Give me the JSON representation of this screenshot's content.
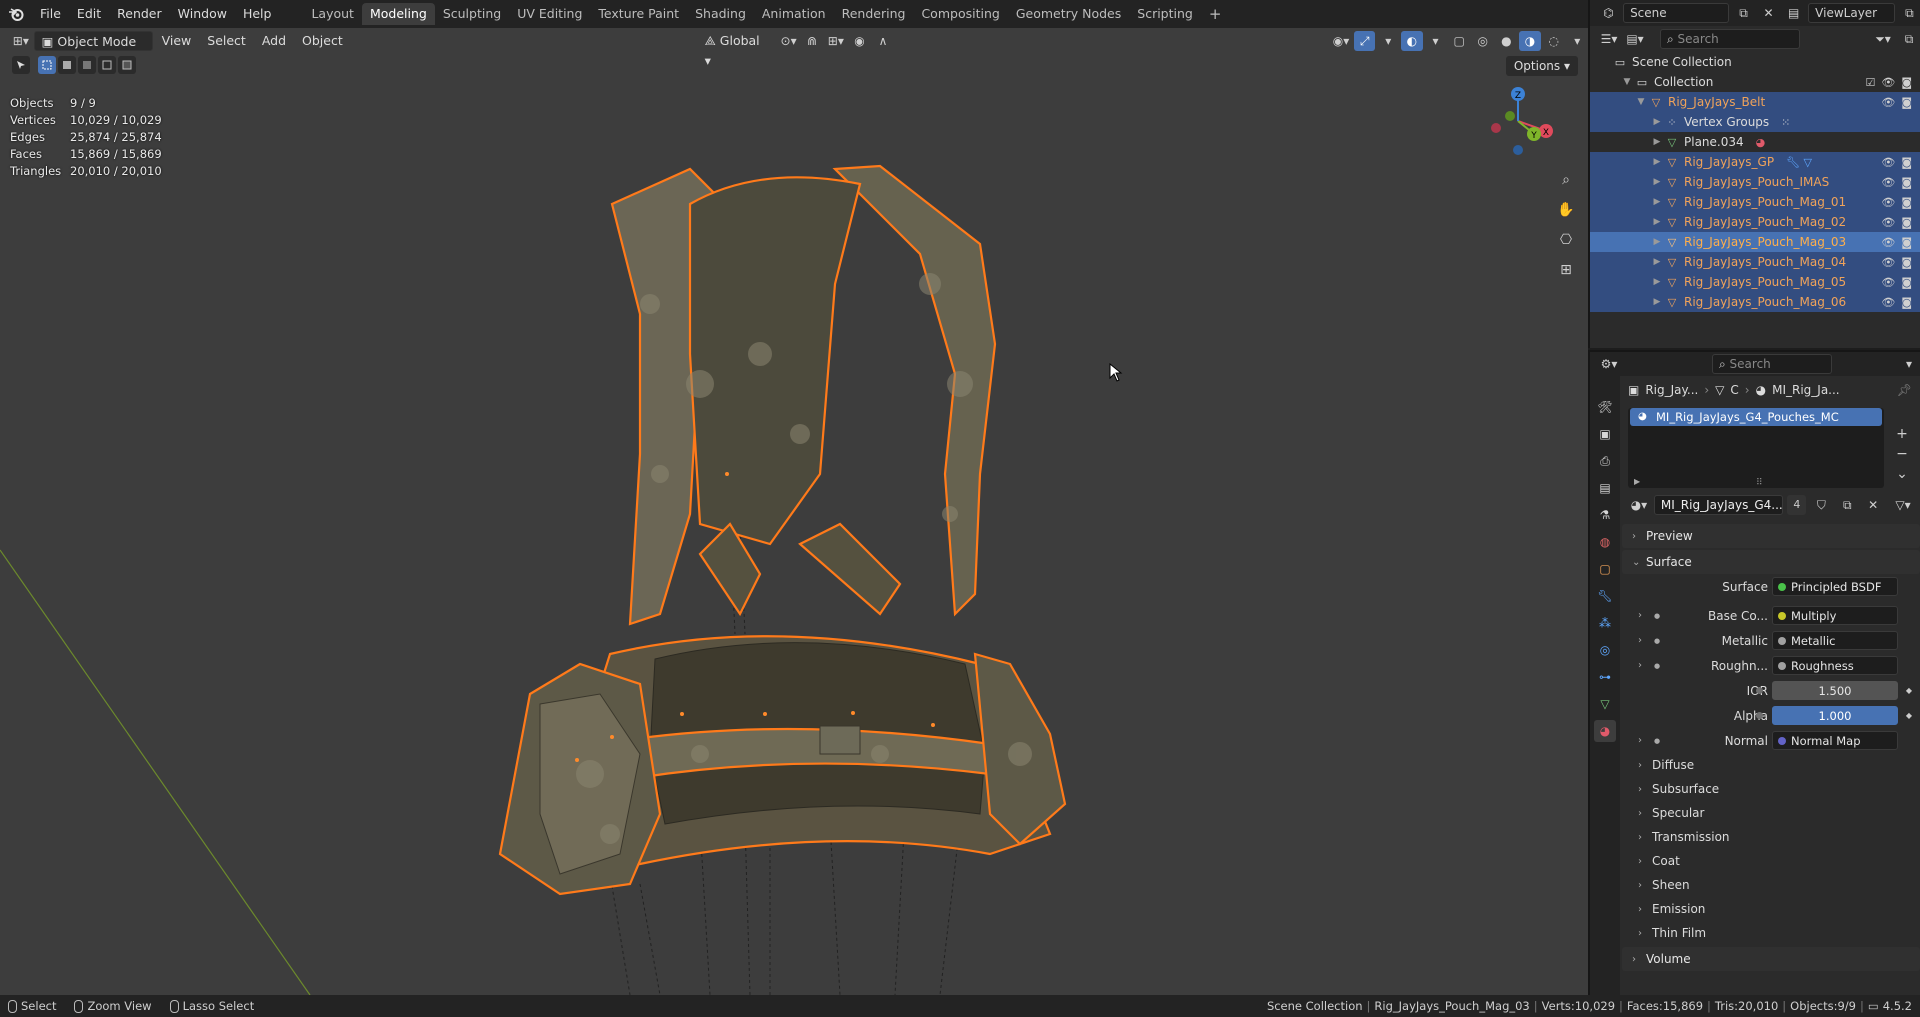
{
  "menu": [
    "File",
    "Edit",
    "Render",
    "Window",
    "Help"
  ],
  "workspaces": [
    {
      "label": "Layout",
      "active": false
    },
    {
      "label": "Modeling",
      "active": true
    },
    {
      "label": "Sculpting",
      "active": false
    },
    {
      "label": "UV Editing",
      "active": false
    },
    {
      "label": "Texture Paint",
      "active": false
    },
    {
      "label": "Shading",
      "active": false
    },
    {
      "label": "Animation",
      "active": false
    },
    {
      "label": "Rendering",
      "active": false
    },
    {
      "label": "Compositing",
      "active": false
    },
    {
      "label": "Geometry Nodes",
      "active": false
    },
    {
      "label": "Scripting",
      "active": false
    }
  ],
  "scene": {
    "name": "Scene",
    "view_layer": "ViewLayer"
  },
  "viewport": {
    "mode": "Object Mode",
    "menus": [
      "View",
      "Select",
      "Add",
      "Object"
    ],
    "orientation": "Global",
    "options_label": "Options",
    "gizmo_axes": [
      "X",
      "Y",
      "Z"
    ],
    "stats": [
      {
        "label": "Objects",
        "value": "9 / 9"
      },
      {
        "label": "Vertices",
        "value": "10,029 / 10,029"
      },
      {
        "label": "Edges",
        "value": "25,874 / 25,874"
      },
      {
        "label": "Faces",
        "value": "15,869 / 15,869"
      },
      {
        "label": "Triangles",
        "value": "20,010 / 20,010"
      }
    ]
  },
  "outliner": {
    "search_placeholder": "Search",
    "root": "Scene Collection",
    "collection": "Collection",
    "rows": [
      {
        "name": "Rig_JayJays_Belt",
        "type": "mesh",
        "sel": true
      },
      {
        "name": "Vertex Groups",
        "type": "vgroup",
        "sel": true
      },
      {
        "name": "Plane.034",
        "type": "mesh-data",
        "sel": false
      },
      {
        "name": "Rig_JayJays_GP",
        "type": "mesh",
        "sel": true
      },
      {
        "name": "Rig_JayJays_Pouch_IMAS",
        "type": "mesh",
        "sel": true
      },
      {
        "name": "Rig_JayJays_Pouch_Mag_01",
        "type": "mesh",
        "sel": true
      },
      {
        "name": "Rig_JayJays_Pouch_Mag_02",
        "type": "mesh",
        "sel": true
      },
      {
        "name": "Rig_JayJays_Pouch_Mag_03",
        "type": "mesh",
        "sel": true,
        "active": true
      },
      {
        "name": "Rig_JayJays_Pouch_Mag_04",
        "type": "mesh",
        "sel": true
      },
      {
        "name": "Rig_JayJays_Pouch_Mag_05",
        "type": "mesh",
        "sel": true
      },
      {
        "name": "Rig_JayJays_Pouch_Mag_06",
        "type": "mesh",
        "sel": true
      }
    ]
  },
  "properties": {
    "search_placeholder": "Search",
    "breadcrumb": [
      "Rig_Jay...",
      "C",
      "MI_Rig_Ja..."
    ],
    "material_slot": "MI_Rig_JayJays_G4_Pouches_MC",
    "material_name": "MI_Rig_JayJays_G4...",
    "material_users": "4",
    "panels": {
      "preview": "Preview",
      "surface": "Surface"
    },
    "surface_shader_label": "Surface",
    "surface_shader": "Principled BSDF",
    "inputs": [
      {
        "label": "Base Co...",
        "value": "Multiply",
        "sock": "#c7c729",
        "kind": "link"
      },
      {
        "label": "Metallic",
        "value": "Metallic",
        "sock": "#a1a1a1",
        "kind": "link"
      },
      {
        "label": "Roughn...",
        "value": "Roughness",
        "sock": "#a1a1a1",
        "kind": "link"
      },
      {
        "label": "IOR",
        "value": "1.500",
        "sock": "#a1a1a1",
        "kind": "num"
      },
      {
        "label": "Alpha",
        "value": "1.000",
        "sock": "#a1a1a1",
        "kind": "num-on"
      },
      {
        "label": "Normal",
        "value": "Normal Map",
        "sock": "#6363c7",
        "kind": "link"
      }
    ],
    "subpanels": [
      "Diffuse",
      "Subsurface",
      "Specular",
      "Transmission",
      "Coat",
      "Sheen",
      "Emission",
      "Thin Film"
    ],
    "volume": "Volume"
  },
  "statusbar": {
    "left": [
      "Select",
      "Zoom View",
      "Lasso Select"
    ],
    "right": [
      "Scene Collection",
      "Rig_JayJays_Pouch_Mag_03",
      "Verts:10,029",
      "Faces:15,869",
      "Tris:20,010",
      "Objects:9/9",
      "4.5.2"
    ]
  },
  "colors": {
    "accent": "#4772b3",
    "selection_outline": "#ff7a1a",
    "selected_name": "#f0a35a"
  }
}
